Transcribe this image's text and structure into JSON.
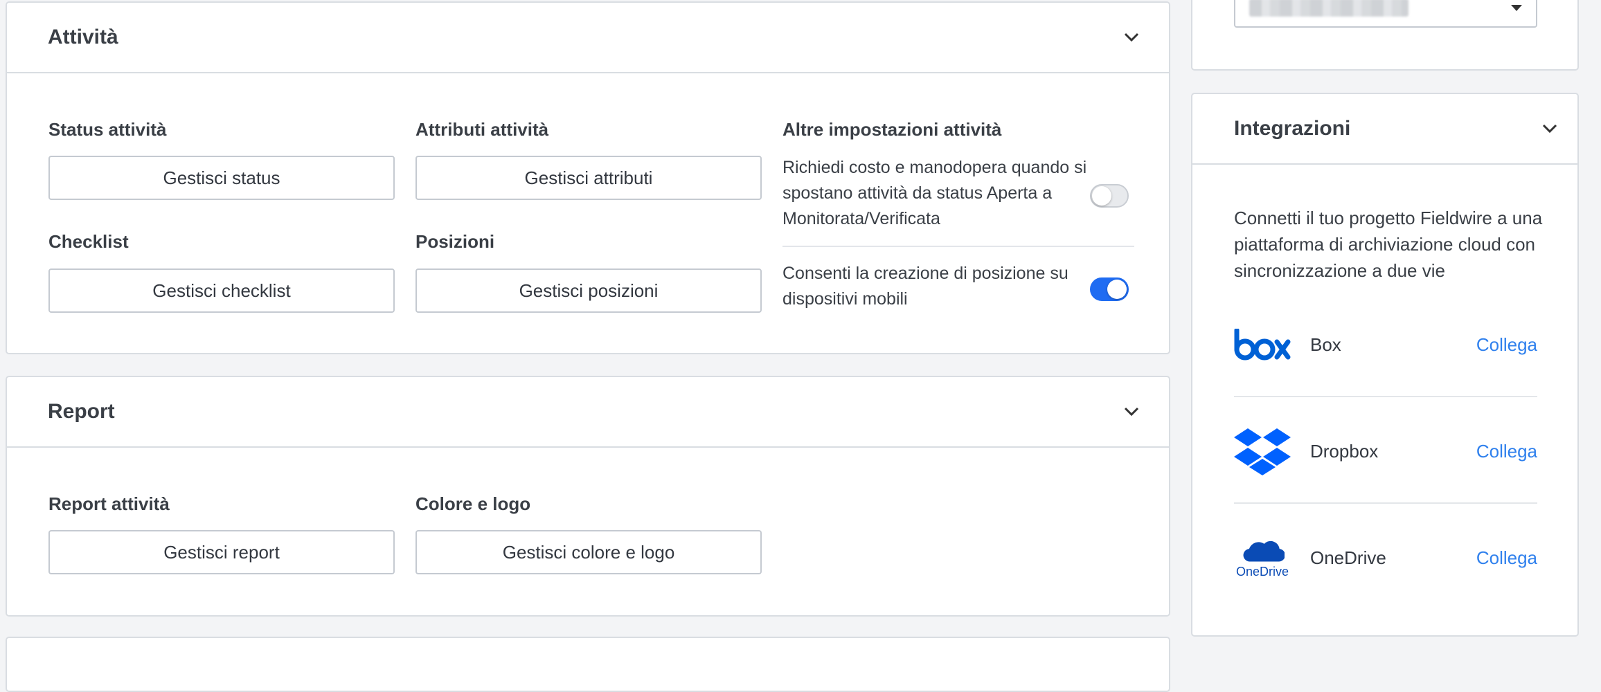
{
  "activities": {
    "title": "Attività",
    "status_label": "Status attività",
    "status_button": "Gestisci status",
    "attributes_label": "Attributi attività",
    "attributes_button": "Gestisci attributi",
    "checklist_label": "Checklist",
    "checklist_button": "Gestisci checklist",
    "locations_label": "Posizioni",
    "locations_button": "Gestisci posizioni",
    "other_label": "Altre impostazioni attività",
    "settings": [
      {
        "text": "Richiedi costo e manodopera quando si spostano attività da status Aperta a Monitorata/Verificata",
        "enabled": false
      },
      {
        "text": "Consenti la creazione di posizione su dispositivi mobili",
        "enabled": true
      }
    ]
  },
  "reports": {
    "title": "Report",
    "report_label": "Report attività",
    "report_button": "Gestisci report",
    "color_label": "Colore e logo",
    "color_button": "Gestisci colore e logo"
  },
  "integrations": {
    "title": "Integrazioni",
    "description": "Connetti il tuo progetto Fieldwire a una piattaforma di archiviazione cloud con sincronizzazione a due vie",
    "items": [
      {
        "name": "Box",
        "icon": "box-logo-icon",
        "action": "Collega"
      },
      {
        "name": "Dropbox",
        "icon": "dropbox-logo-icon",
        "action": "Collega"
      },
      {
        "name": "OneDrive",
        "icon": "onedrive-logo-icon",
        "action": "Collega",
        "logo_text": "OneDrive"
      }
    ]
  },
  "colors": {
    "accent": "#1f6cf2",
    "link": "#2f80ed",
    "box": "#0061d5",
    "dropbox": "#0061fe",
    "onedrive": "#0a4bb5"
  }
}
